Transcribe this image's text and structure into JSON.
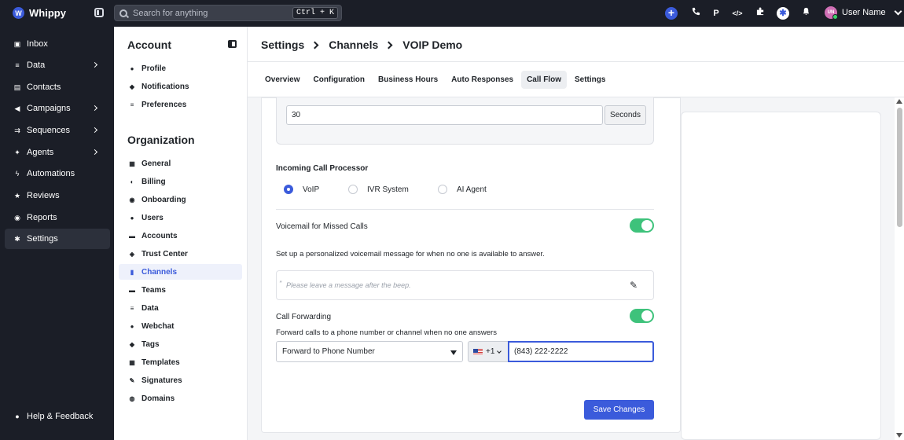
{
  "app": {
    "name": "Whippy",
    "logo_letter": "W",
    "search_placeholder": "Search for anything",
    "search_shortcut": "Ctrl + K",
    "user_name": "User Name",
    "user_initials": "UN"
  },
  "topbar_icons": [
    "plus-icon",
    "phone-call-icon",
    "parking-icon",
    "code-icon",
    "puzzle-icon",
    "help-badge-icon",
    "bell-icon"
  ],
  "topbar_p_label": "P",
  "topbar_code_label": "</>",
  "sidebar": {
    "items": [
      {
        "label": "Inbox",
        "icon": "inbox-icon",
        "has_chevron": false,
        "active": false
      },
      {
        "label": "Data",
        "icon": "database-icon",
        "has_chevron": true,
        "active": false
      },
      {
        "label": "Contacts",
        "icon": "contacts-icon",
        "has_chevron": false,
        "active": false
      },
      {
        "label": "Campaigns",
        "icon": "megaphone-icon",
        "has_chevron": true,
        "active": false
      },
      {
        "label": "Sequences",
        "icon": "sequence-icon",
        "has_chevron": true,
        "active": false
      },
      {
        "label": "Agents",
        "icon": "agent-icon",
        "has_chevron": true,
        "active": false
      },
      {
        "label": "Automations",
        "icon": "lightning-icon",
        "has_chevron": false,
        "active": false
      },
      {
        "label": "Reviews",
        "icon": "star-icon",
        "has_chevron": false,
        "active": false
      },
      {
        "label": "Reports",
        "icon": "report-icon",
        "has_chevron": false,
        "active": false
      },
      {
        "label": "Settings",
        "icon": "gear-icon",
        "has_chevron": false,
        "active": true
      }
    ],
    "help_label": "Help & Feedback"
  },
  "settings_nav": {
    "account_title": "Account",
    "account_items": [
      {
        "label": "Profile",
        "icon": "user-icon"
      },
      {
        "label": "Notifications",
        "icon": "bell-icon"
      },
      {
        "label": "Preferences",
        "icon": "sliders-icon"
      }
    ],
    "org_title": "Organization",
    "org_items": [
      {
        "label": "General",
        "icon": "grid-icon",
        "active": false
      },
      {
        "label": "Billing",
        "icon": "billing-icon",
        "active": false
      },
      {
        "label": "Onboarding",
        "icon": "onboarding-icon",
        "active": false
      },
      {
        "label": "Users",
        "icon": "users-icon",
        "active": false
      },
      {
        "label": "Accounts",
        "icon": "building-icon",
        "active": false
      },
      {
        "label": "Trust Center",
        "icon": "shield-icon",
        "active": false
      },
      {
        "label": "Channels",
        "icon": "channels-icon",
        "active": true
      },
      {
        "label": "Teams",
        "icon": "teams-icon",
        "active": false
      },
      {
        "label": "Data",
        "icon": "database-icon",
        "active": false
      },
      {
        "label": "Webchat",
        "icon": "chat-icon",
        "active": false
      },
      {
        "label": "Tags",
        "icon": "tag-icon",
        "active": false
      },
      {
        "label": "Templates",
        "icon": "template-icon",
        "active": false
      },
      {
        "label": "Signatures",
        "icon": "signature-icon",
        "active": false
      },
      {
        "label": "Domains",
        "icon": "globe-icon",
        "active": false
      }
    ]
  },
  "breadcrumb": [
    "Settings",
    "Channels",
    "VOIP Demo"
  ],
  "tabs": [
    {
      "label": "Overview",
      "active": false
    },
    {
      "label": "Configuration",
      "active": false
    },
    {
      "label": "Business Hours",
      "active": false
    },
    {
      "label": "Auto Responses",
      "active": false
    },
    {
      "label": "Call Flow",
      "active": true
    },
    {
      "label": "Settings",
      "active": false
    }
  ],
  "call_flow": {
    "timeout_value": "30",
    "timeout_unit": "Seconds",
    "processor_label": "Incoming Call Processor",
    "processor_options": [
      {
        "label": "VoIP",
        "checked": true
      },
      {
        "label": "IVR System",
        "checked": false
      },
      {
        "label": "AI Agent",
        "checked": false
      }
    ],
    "voicemail_label": "Voicemail for Missed Calls",
    "voicemail_enabled": true,
    "voicemail_description": "Set up a personalized voicemail message for when no one is available to answer.",
    "voicemail_placeholder": "Please leave a message after the beep.",
    "forwarding_label": "Call Forwarding",
    "forwarding_enabled": true,
    "forwarding_description": "Forward calls to a phone number or channel when no one answers",
    "forward_type": "Forward to Phone Number",
    "country_code": "+1",
    "phone_number": "(843) 222-2222",
    "save_label": "Save Changes"
  },
  "colors": {
    "accent": "#3b5bdb",
    "toggle_on": "#3ec27b",
    "sidebar_bg": "#1b1e27"
  }
}
